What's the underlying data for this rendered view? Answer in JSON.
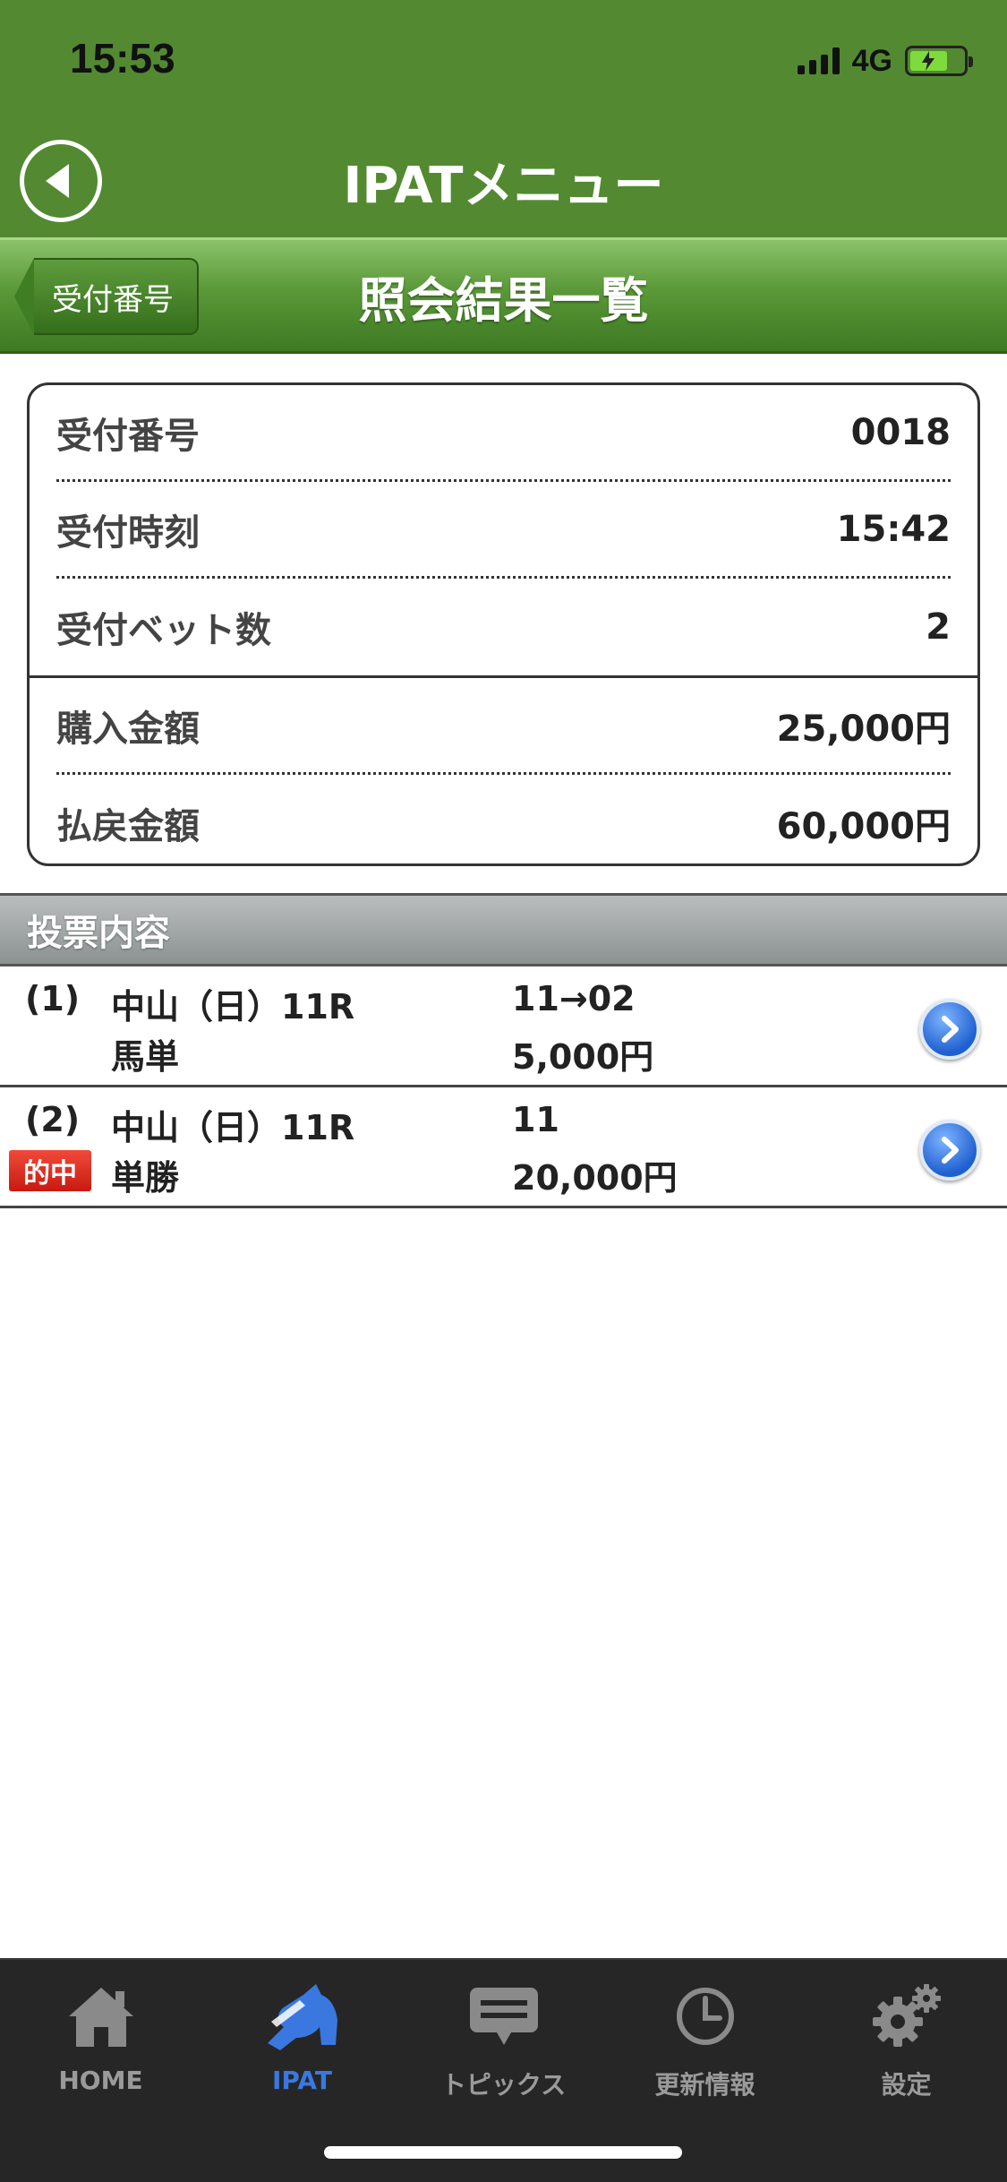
{
  "status_bar": {
    "time": "15:53",
    "network": "4G"
  },
  "header": {
    "title": "IPATメニュー"
  },
  "sub_header": {
    "back_label": "受付番号",
    "title": "照会結果一覧"
  },
  "summary": {
    "rows": [
      {
        "label": "受付番号",
        "value": "0018"
      },
      {
        "label": "受付時刻",
        "value": "15:42"
      },
      {
        "label": "受付ベット数",
        "value": "2"
      },
      {
        "label": "購入金額",
        "value": "25,000円"
      },
      {
        "label": "払戻金額",
        "value": "60,000円"
      }
    ]
  },
  "votes": {
    "section_title": "投票内容",
    "items": [
      {
        "number": "(1)",
        "venue": "中山（日）11R",
        "bet_type": "馬単",
        "combination": "11→02",
        "amount": "5,000円",
        "hit": false
      },
      {
        "number": "(2)",
        "venue": "中山（日）11R",
        "bet_type": "単勝",
        "combination": "11",
        "amount": "20,000円",
        "hit": true,
        "hit_label": "的中"
      }
    ]
  },
  "tab_bar": {
    "items": [
      {
        "label": "HOME",
        "icon": "home-icon"
      },
      {
        "label": "IPAT",
        "icon": "horse-icon",
        "active": true
      },
      {
        "label": "トピックス",
        "icon": "chat-icon"
      },
      {
        "label": "更新情報",
        "icon": "clock-icon"
      },
      {
        "label": "設定",
        "icon": "gear-icon"
      }
    ]
  },
  "colors": {
    "header_green": "#538a31",
    "active_tab": "#3a78e0",
    "hit_red": "#d8261a"
  }
}
